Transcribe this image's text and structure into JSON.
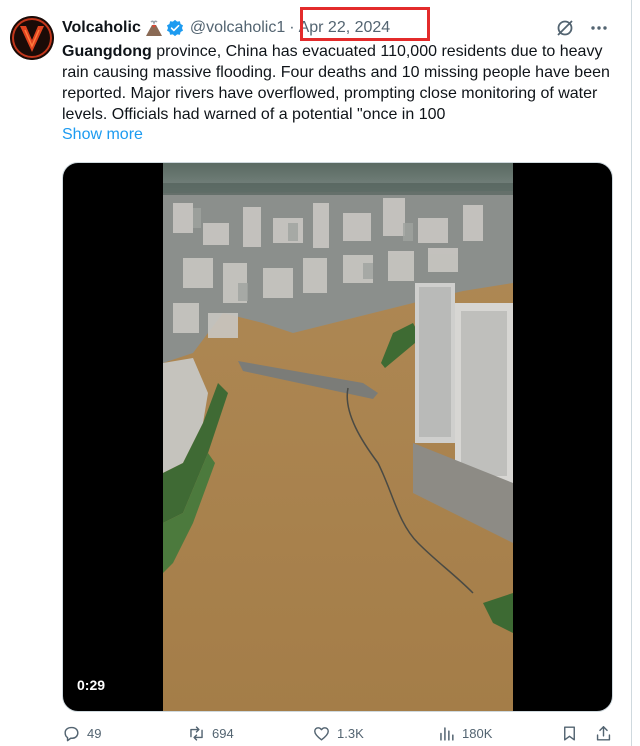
{
  "tweet": {
    "author_name": "Volcaholic",
    "author_emoji": "volcano-emoji",
    "handle": "@volcaholic1",
    "separator": "·",
    "date": "Apr 22, 2024",
    "text_bold": "Guangdong",
    "text_rest": " province, China has evacuated 110,000 residents due to heavy rain causing massive flooding. Four deaths and 10 missing people have been reported. Major rivers have overflowed, prompting close monitoring of water levels. Officials had warned of a potential \"once in 100",
    "show_more": "Show more",
    "video_timestamp": "0:29"
  },
  "actions": {
    "replies": "49",
    "reposts": "694",
    "likes": "1.3K",
    "views": "180K"
  },
  "colors": {
    "accent": "#1d9bf0",
    "muted": "#536471",
    "highlight_box": "#e32b2b",
    "flood_water": "#a9834f"
  },
  "icons": [
    "grok-icon",
    "more-icon",
    "verified-badge-icon",
    "reply-icon",
    "repost-icon",
    "like-icon",
    "views-icon",
    "bookmark-icon",
    "share-icon"
  ]
}
